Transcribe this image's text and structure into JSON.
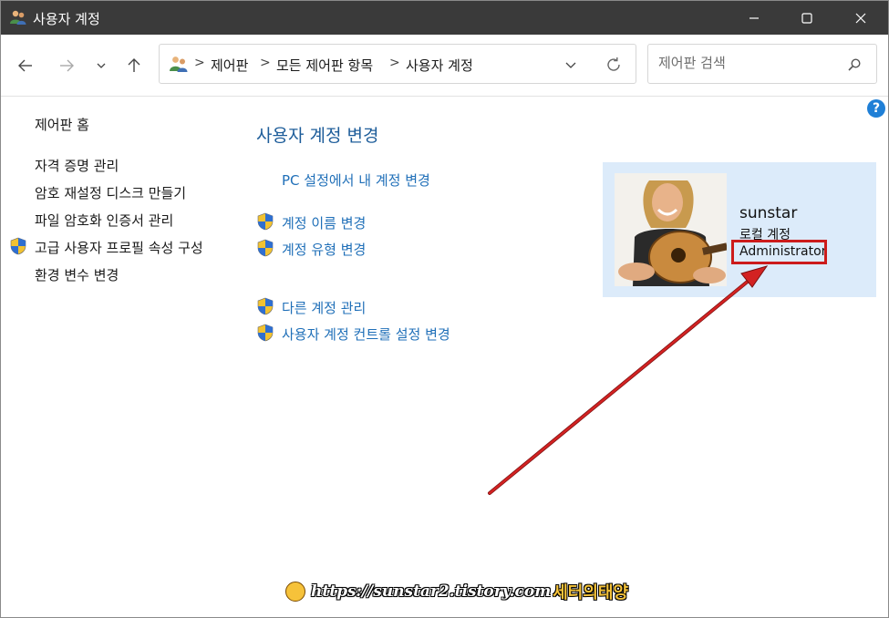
{
  "window": {
    "title": "사용자 계정",
    "icon": "users-icon"
  },
  "titlebar_buttons": [
    "minimize-icon",
    "maximize-icon",
    "close-icon"
  ],
  "nav": {
    "back": "arrow-left-icon",
    "forward": "arrow-right-icon",
    "recent": "chevron-down-icon",
    "up": "arrow-up-icon"
  },
  "address": {
    "breadcrumbs": [
      "제어판",
      "모든 제어판 항목",
      "사용자 계정"
    ],
    "separator": ">"
  },
  "search": {
    "placeholder": "제어판 검색"
  },
  "help": "?",
  "left_panel": {
    "home": "제어판 홈",
    "links": [
      "자격 증명 관리",
      "암호 재설정 디스크 만들기",
      "파일 암호화 인증서 관리",
      "고급 사용자 프로필 속성 구성",
      "환경 변수 변경"
    ]
  },
  "main": {
    "heading": "사용자 계정 변경",
    "pc_settings_link": "PC 설정에서 내 계정 변경",
    "links_group1": [
      "계정 이름 변경",
      "계정 유형 변경"
    ],
    "links_group2": [
      "다른 계정 관리",
      "사용자 계정 컨트롤 설정 변경"
    ]
  },
  "user": {
    "name": "sunstar",
    "account_type": "로컬 계정",
    "role": "Administrator"
  },
  "watermark": {
    "url": "https://sunstar2.tistory.com",
    "name": "세터의태양"
  },
  "colors": {
    "titlebar": "#3a3a3a",
    "link": "#1f6fb8",
    "heading": "#1e5d9a",
    "card": "#dcebfa",
    "highlight": "#cc1b1b"
  }
}
